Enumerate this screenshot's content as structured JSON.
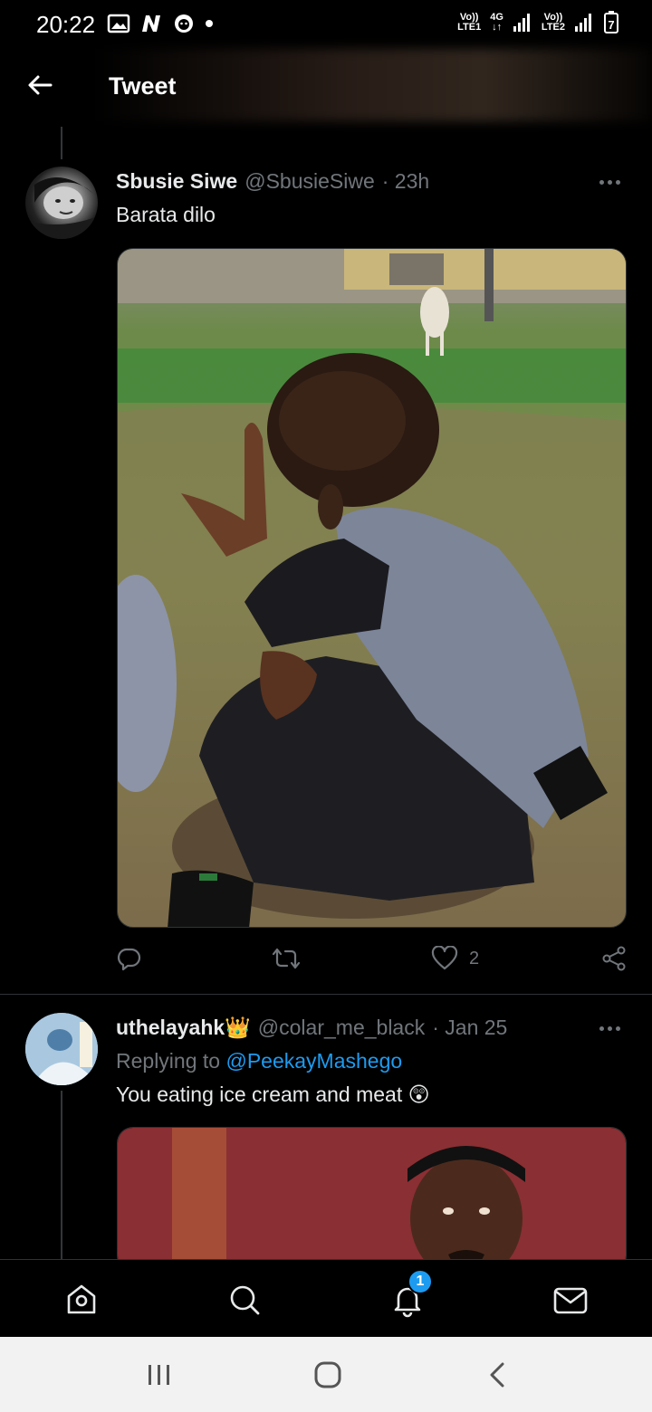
{
  "status_bar": {
    "time": "20:22",
    "icons_left": [
      "gallery-icon",
      "n-icon",
      "face-icon",
      "dot"
    ],
    "sim1": {
      "top": "Vo))",
      "bottom": "LTE1"
    },
    "sim1_network": "4G",
    "sim2": {
      "top": "Vo))",
      "bottom": "LTE2"
    },
    "battery_level": "7"
  },
  "header": {
    "title": "Tweet"
  },
  "tweets": [
    {
      "name": "Sbusie Siwe",
      "handle": "@SbusieSiwe",
      "time": "· 23h",
      "text": "Barata dilo",
      "reply_count": "",
      "retweet_count": "",
      "like_count": "2"
    },
    {
      "name": "uthelayahk",
      "name_emoji": "👑",
      "handle": "@colar_me_black",
      "time": "· Jan 25",
      "replying_prefix": "Replying to",
      "replying_to": "@PeekayMashego",
      "text": "You eating ice cream and meat",
      "text_emoji": "😲"
    }
  ],
  "bottom_nav": {
    "items": [
      "home-icon",
      "search-icon",
      "notifications-icon",
      "messages-icon"
    ],
    "notification_badge": "1"
  },
  "colors": {
    "background": "#000000",
    "text_primary": "#e7e9ea",
    "text_secondary": "#71767b",
    "accent": "#1d9bf0",
    "divider": "#2f3336"
  }
}
